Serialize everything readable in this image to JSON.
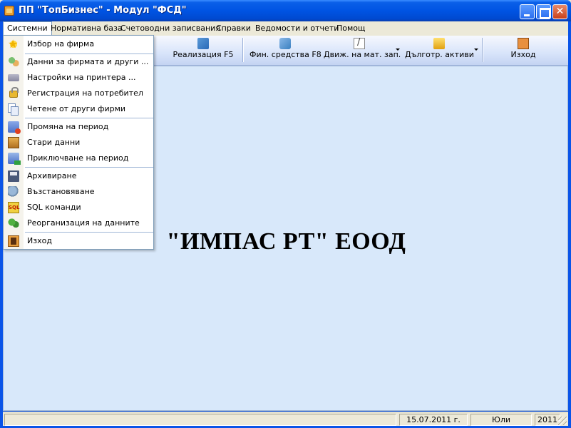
{
  "window": {
    "title": "ПП \"ТопБизнес\" - Модул \"ФСД\"",
    "minimize": "",
    "maximize": "",
    "close": "✕"
  },
  "menubar": {
    "items": [
      {
        "label": "Системни"
      },
      {
        "label": "Нормативна база"
      },
      {
        "label": "Счетоводни записвания"
      },
      {
        "label": "Справки"
      },
      {
        "label": "Ведомости и отчети"
      },
      {
        "label": "Помощ"
      }
    ]
  },
  "toolbar": {
    "items": [
      {
        "label": "Реализация F5",
        "icon": "sales-icon"
      },
      {
        "label": "Фин. средства F8",
        "icon": "finance-icon"
      },
      {
        "label": "Движ. на мат. зап.",
        "icon": "materials-icon"
      },
      {
        "label": "Дълготр. активи",
        "icon": "assets-icon"
      },
      {
        "label": "Изход",
        "icon": "exit-icon"
      }
    ]
  },
  "dropdown": {
    "items": [
      {
        "label": "Избор на фирма",
        "icon": "star-icon"
      },
      {
        "label": "Данни за фирмата и други ...",
        "icon": "people-icon"
      },
      {
        "label": "Настройки на принтера ...",
        "icon": "printer-icon"
      },
      {
        "label": "Регистрация на потребител",
        "icon": "lock-icon"
      },
      {
        "label": "Четене от други фирми",
        "icon": "copy-icon"
      },
      {
        "label": "Промяна на период",
        "icon": "period-icon"
      },
      {
        "label": "Стари данни",
        "icon": "box-icon"
      },
      {
        "label": "Приключване на период",
        "icon": "close-period-icon"
      },
      {
        "label": "Архивиране",
        "icon": "floppy-icon"
      },
      {
        "label": "Възстановяване",
        "icon": "restore-icon"
      },
      {
        "label": "SQL команди",
        "icon": "sql-icon"
      },
      {
        "label": "Реорганизация на данните",
        "icon": "reorganize-icon"
      },
      {
        "label": "Изход",
        "icon": "exit-icon"
      }
    ],
    "sql_icon_text": "SQL"
  },
  "client": {
    "company_name": "\"ИМПАС РТ\" ЕООД"
  },
  "statusbar": {
    "date": "15.07.2011 г.",
    "month": "Юли",
    "year": "2011"
  },
  "colors": {
    "titlebar": "#0054e3",
    "client_background": "#d8e8fa",
    "menu_border": "#7f9db9"
  }
}
